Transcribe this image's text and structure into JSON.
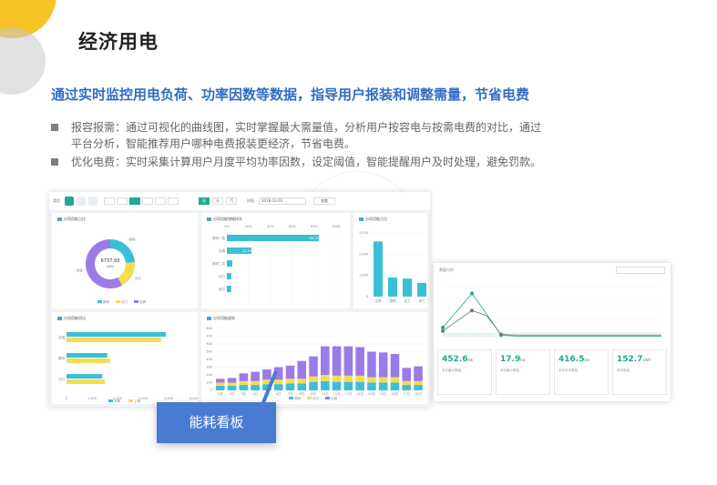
{
  "title": "经济用电",
  "subtitle": "通过实时监控用电负荷、功率因数等数据，指导用户报装和调整需量，节省电费",
  "bullets": [
    {
      "line1": "报容报需：通过可视化的曲线图，实时掌握最大需量值，分析用户按容电与按需电费的对比，通过",
      "line2": "平台分析，智能推荐用户哪种电费报装更经济，节省电费。"
    },
    {
      "line1": "优化电费：实时采集计算用户月度平均功率因数，设定阈值，智能提醒用户及时处理，避免罚款。",
      "line2": ""
    }
  ],
  "caption": "能耗看板",
  "colors": {
    "accent": "#2f6ec6",
    "cyan": "#3bbfd6",
    "yellow": "#f5dc52",
    "purple": "#9b7be8",
    "green": "#22a88f",
    "caption_bg": "#4a7bd2"
  },
  "dashboard": {
    "toolbar": {
      "label1": "类型",
      "btn1": "电",
      "btn2": "水",
      "btn3": "汽",
      "range_label": "时段",
      "range_value": "2018-12-03",
      "search": "查看"
    },
    "donut": {
      "title": "分项用能占比",
      "center_value": "6737.93",
      "center_unit": "kWh",
      "slices": [
        {
          "name": "照明",
          "value": 24
        },
        {
          "name": "动力",
          "value": 18
        },
        {
          "name": "空调",
          "value": 58
        }
      ],
      "legend": [
        "照明",
        "动力",
        "空调"
      ]
    },
    "hbar_rank": {
      "title": "分项用能增幅排名",
      "axis": [
        "0%",
        "20%",
        "40%",
        "60%",
        "80%",
        "100%"
      ],
      "rows": [
        {
          "name": "照明一层",
          "value": 84.3,
          "label": "84.3%"
        },
        {
          "name": "空调",
          "value": 22.5,
          "label": "22.5%"
        },
        {
          "name": "照明二层",
          "value": 5,
          "label": ""
        },
        {
          "name": "动力",
          "value": 4,
          "label": ""
        },
        {
          "name": "其它",
          "value": 4,
          "label": ""
        }
      ]
    },
    "vbar": {
      "title": "分项用能占比",
      "y_ticks": [
        "3,000",
        "2,000",
        "1,000",
        "0"
      ],
      "categories": [
        "空调",
        "照明",
        "动力",
        "其它"
      ],
      "values": [
        2600,
        900,
        850,
        650
      ]
    },
    "compare": {
      "title": "分项用能同比",
      "x_ticks": [
        "0",
        "1,000",
        "2,000",
        "3,000",
        "4,000",
        "5,000"
      ],
      "categories": [
        "空调",
        "照明",
        "动力"
      ],
      "series": [
        {
          "name": "本期",
          "values": [
            3900,
            1600,
            1400
          ]
        },
        {
          "name": "上期",
          "values": [
            3700,
            1700,
            1500
          ]
        }
      ]
    },
    "stacked": {
      "title": "分项用能趋势",
      "y_ticks": [
        "800",
        "700",
        "600",
        "500",
        "400",
        "300",
        "200",
        "100",
        "0"
      ],
      "categories": [
        "1日",
        "2日",
        "3日",
        "4日",
        "5日",
        "6日",
        "7日",
        "8日",
        "9日",
        "10日",
        "11日",
        "12日",
        "13日",
        "14日",
        "15日",
        "16日",
        "17日",
        "18日"
      ],
      "series": [
        {
          "name": "照明",
          "values": [
            60,
            60,
            70,
            70,
            80,
            80,
            90,
            90,
            110,
            120,
            110,
            110,
            110,
            100,
            100,
            100,
            70,
            70
          ]
        },
        {
          "name": "动力",
          "values": [
            40,
            40,
            50,
            50,
            60,
            60,
            60,
            60,
            70,
            80,
            80,
            80,
            80,
            70,
            70,
            70,
            50,
            50
          ]
        },
        {
          "name": "空调",
          "values": [
            50,
            60,
            100,
            120,
            130,
            160,
            170,
            230,
            260,
            370,
            380,
            380,
            370,
            330,
            320,
            300,
            170,
            190
          ]
        }
      ]
    }
  },
  "dashboard2": {
    "title": "需量分析",
    "lines": [
      {
        "name": "实时需量",
        "values": [
          40,
          90,
          140,
          80,
          18,
          15,
          15,
          15,
          15,
          15,
          15,
          15,
          15,
          15,
          15,
          15
        ]
      },
      {
        "name": "申报需量",
        "values": [
          30,
          60,
          90,
          75,
          20,
          18,
          18,
          18,
          18,
          18,
          18,
          18,
          18,
          18,
          18,
          18
        ]
      }
    ],
    "kpis": [
      {
        "value": "452.6",
        "unit": "kw",
        "label": "本月最大需量"
      },
      {
        "value": "17.9",
        "unit": "kw",
        "label": "本月最小需量"
      },
      {
        "value": "416.5",
        "unit": "kw",
        "label": "本月平均需量"
      },
      {
        "value": "152.7",
        "unit": "kWh",
        "label": "本月电费"
      }
    ]
  }
}
